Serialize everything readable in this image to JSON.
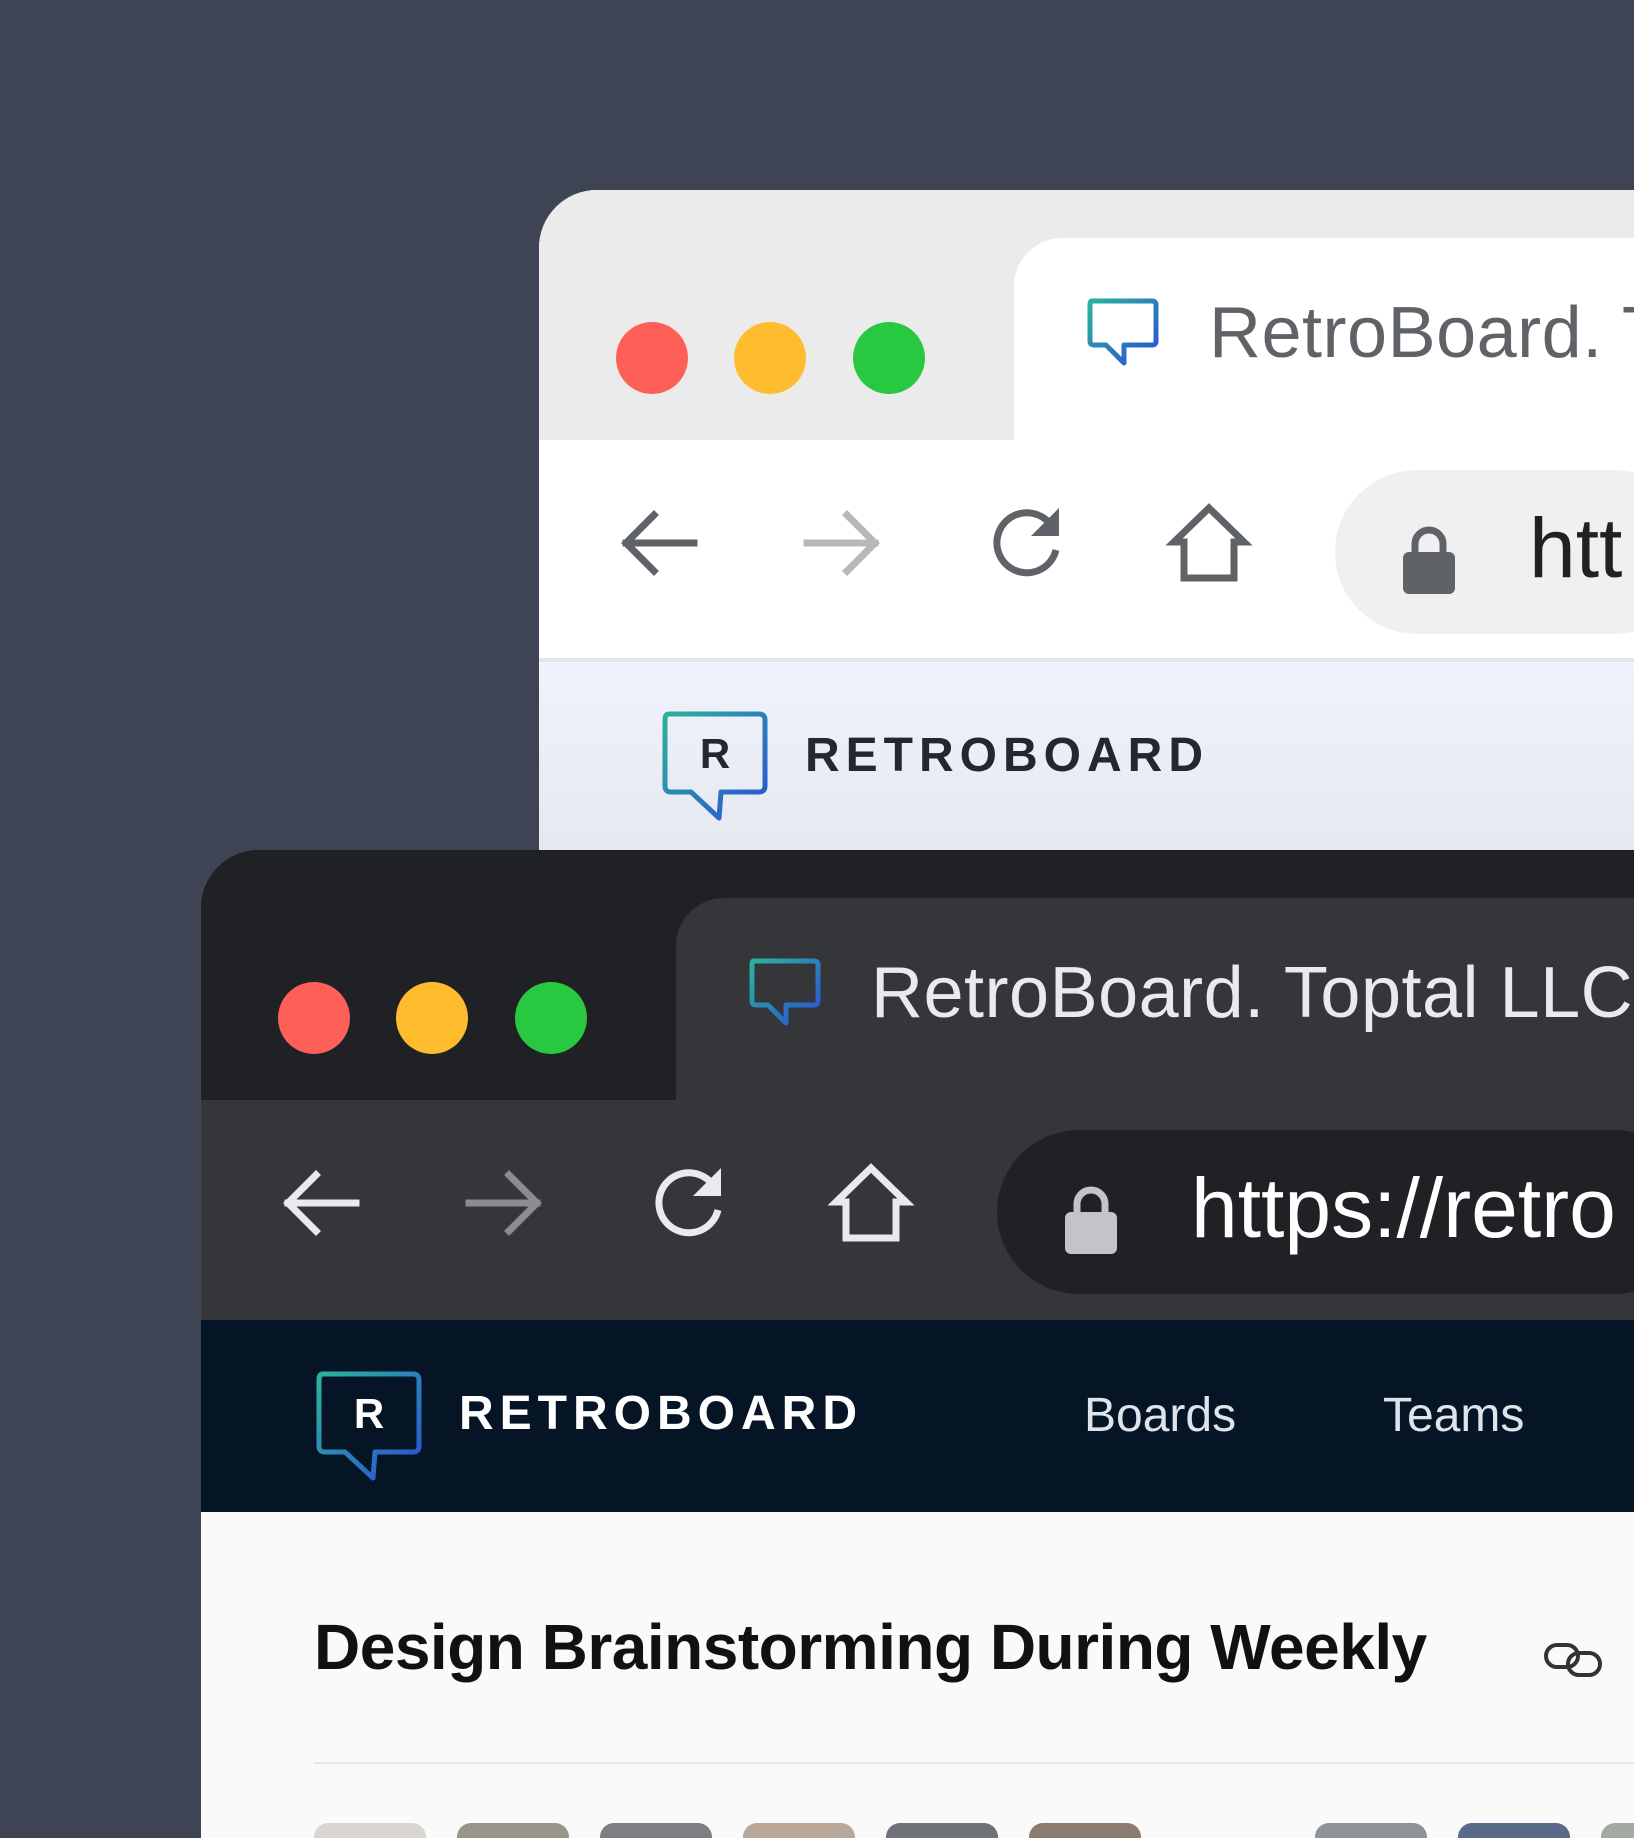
{
  "light_window": {
    "tab_title": "RetroBoard. T",
    "url": "htt",
    "brand_initial": "R",
    "brand_name": "RETROBOARD"
  },
  "dark_window": {
    "tab_title": "RetroBoard. Toptal LLC.",
    "url": "https://retro",
    "brand_initial": "R",
    "brand_name": "RETROBOARD",
    "nav": {
      "boards": "Boards",
      "teams": "Teams"
    },
    "board_title": "Design Brainstorming During Weekly"
  },
  "icons": {
    "tab_favicon": "speech-bubble-icon",
    "back": "arrow-left-icon",
    "forward": "arrow-right-icon",
    "reload": "reload-icon",
    "home": "home-icon",
    "lock": "lock-icon",
    "copy_link": "link-icon"
  },
  "colors": {
    "backdrop": "#3e4453",
    "traffic_red": "#fe5f57",
    "traffic_yellow": "#febc2e",
    "traffic_green": "#28c840",
    "app_nav_bg": "#061526",
    "logo_gradient_start": "#2bb39a",
    "logo_gradient_end": "#2b4fd6"
  }
}
